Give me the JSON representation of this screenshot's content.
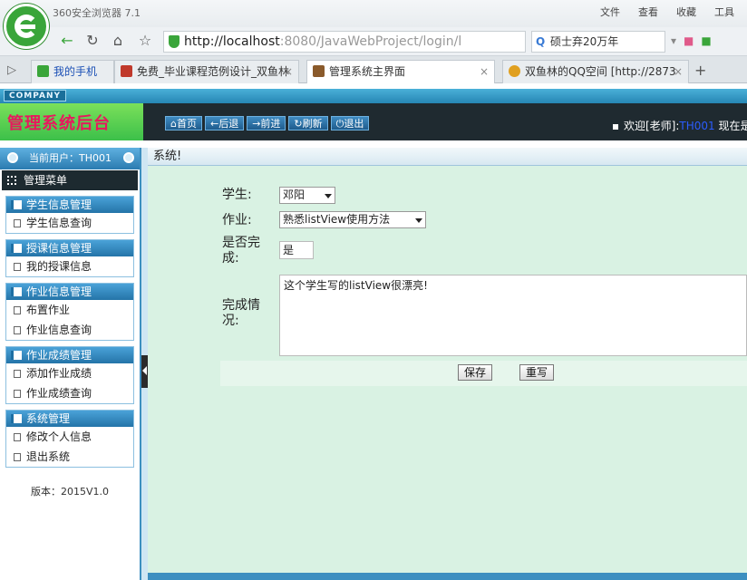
{
  "browser": {
    "app_title": "360安全浏览器 7.1",
    "menu": [
      "文件",
      "查看",
      "收藏",
      "工具"
    ],
    "url_host": "http://localhost",
    "url_rest": ":8080/JavaWebProject/login/l",
    "search_text": "硕士弃20万年",
    "tabs": [
      {
        "label": "我的手机",
        "icon_color": "#3aa53a",
        "link": true
      },
      {
        "label": "免费_毕业课程范例设计_双鱼林",
        "icon_color": "#c0392b",
        "link": false
      },
      {
        "label": "管理系统主界面",
        "icon_color": "#8a5a2b",
        "link": false
      },
      {
        "label": "双鱼林的QQ空间 [http://2873",
        "icon_color": "#e0a020",
        "link": false
      }
    ]
  },
  "header": {
    "company": "COMPANY",
    "title": "管理系统后台",
    "toolbar": [
      "首页",
      "后退",
      "前进",
      "刷新",
      "退出"
    ],
    "welcome_prefix": "欢迎[老师]:",
    "welcome_user": "TH001",
    "welcome_suffix": " 现在是"
  },
  "sidebar": {
    "current_user": "当前用户：TH001",
    "menu_title": "管理菜单",
    "groups": [
      {
        "title": "学生信息管理",
        "items": [
          "学生信息查询"
        ]
      },
      {
        "title": "授课信息管理",
        "items": [
          "我的授课信息"
        ]
      },
      {
        "title": "作业信息管理",
        "items": [
          "布置作业",
          "作业信息查询"
        ]
      },
      {
        "title": "作业成绩管理",
        "items": [
          "添加作业成绩",
          "作业成绩查询"
        ]
      },
      {
        "title": "系统管理",
        "items": [
          "修改个人信息",
          "退出系统"
        ]
      }
    ],
    "version": "版本：2015V1.0"
  },
  "content": {
    "crumb": "系统!",
    "form": {
      "student_label": "学生:",
      "student_value": "邓阳",
      "homework_label": "作业:",
      "homework_value": "熟悉listView使用方法",
      "done_label": "是否完成:",
      "done_value": "是",
      "desc_label": "完成情况:",
      "desc_value": "这个学生写的listView很漂亮!",
      "save_label": "保存",
      "reset_label": "重写"
    }
  },
  "colors": {
    "header_bg": "#1f2a30",
    "admin_green": "#3cc04a",
    "title_pink": "#e8185e",
    "accent_blue": "#2474a8",
    "content_bg": "#d9f2e3"
  }
}
